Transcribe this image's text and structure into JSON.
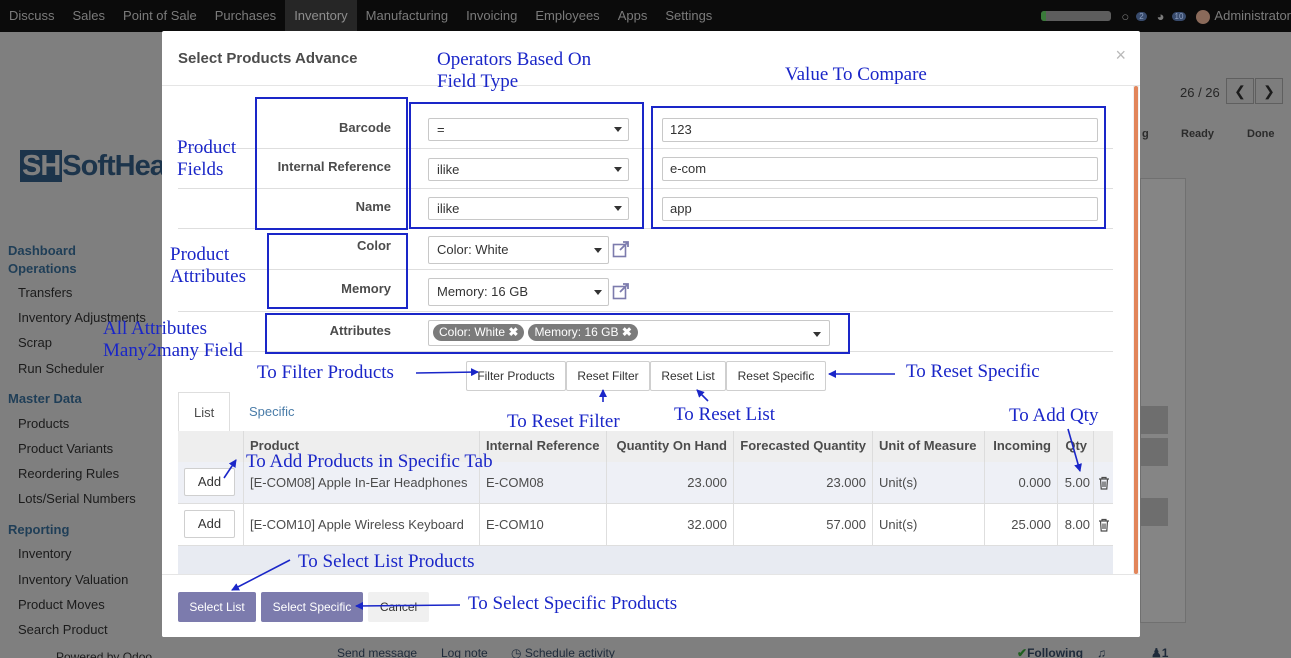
{
  "topbar": {
    "menu": [
      "Discuss",
      "Sales",
      "Point of Sale",
      "Purchases",
      "Inventory",
      "Manufacturing",
      "Invoicing",
      "Employees",
      "Apps",
      "Settings"
    ],
    "active_menu": "Inventory",
    "badge_chat": "2",
    "badge_activity": "10",
    "user": "Administrator"
  },
  "sidebar": {
    "logo_text": "Soft",
    "dashboard_heading": "Dashboard Operations",
    "ops_items": [
      "Transfers",
      "Inventory Adjustments",
      "Scrap",
      "Run Scheduler"
    ],
    "master_heading": "Master Data",
    "master_items": [
      "Products",
      "Product Variants",
      "Reordering Rules",
      "Lots/Serial Numbers"
    ],
    "reporting_heading": "Reporting",
    "reporting_items": [
      "Inventory",
      "Inventory Valuation",
      "Product Moves",
      "Search Product"
    ],
    "powered": "Powered by Odoo"
  },
  "background": {
    "pager": "26 / 26",
    "stage_ready": "Ready",
    "stage_done": "Done",
    "stage_partial": "g",
    "send_message": "Send message",
    "log_note": "Log note",
    "schedule_activity": "Schedule activity",
    "following": "Following",
    "followers": "1"
  },
  "modal": {
    "title": "Select Products Advance",
    "close": "×",
    "fields": [
      {
        "label": "Barcode",
        "operator": "=",
        "value": "123"
      },
      {
        "label": "Internal Reference",
        "operator": "ilike",
        "value": "e-com"
      },
      {
        "label": "Name",
        "operator": "ilike",
        "value": "app"
      }
    ],
    "attributes": [
      {
        "label": "Color",
        "value": "Color: White"
      },
      {
        "label": "Memory",
        "value": "Memory: 16 GB"
      }
    ],
    "attributes_label": "Attributes",
    "attribute_tags": [
      "Color: White",
      "Memory: 16 GB"
    ],
    "buttons": {
      "filter": "Filter Products",
      "reset_filter": "Reset Filter",
      "reset_list": "Reset List",
      "reset_specific": "Reset Specific"
    },
    "tabs": [
      "List",
      "Specific"
    ],
    "table": {
      "headers": [
        "Product",
        "Internal Reference",
        "Quantity On Hand",
        "Forecasted Quantity",
        "Unit of Measure",
        "Incoming",
        "Qty"
      ],
      "add_label": "Add",
      "rows": [
        {
          "product": "[E-COM08] Apple In-Ear Headphones",
          "ref": "E-COM08",
          "onhand": "23.000",
          "forecast": "23.000",
          "uom": "Unit(s)",
          "incoming": "0.000",
          "qty": "5.00"
        },
        {
          "product": "[E-COM10] Apple Wireless Keyboard",
          "ref": "E-COM10",
          "onhand": "32.000",
          "forecast": "57.000",
          "uom": "Unit(s)",
          "incoming": "25.000",
          "qty": "8.00"
        }
      ]
    },
    "footer": {
      "select_list": "Select List",
      "select_specific": "Select Specific",
      "cancel": "Cancel"
    }
  },
  "annotations": {
    "operators": "Operators Based On Field Type",
    "operators_l1": "Operators Based On",
    "operators_l2": "Field Type",
    "value_compare": "Value To Compare",
    "product_fields_l1": "Product",
    "product_fields_l2": "Fields",
    "product_attrs_l1": "Product",
    "product_attrs_l2": "Attributes",
    "all_attrs_l1": "All Attributes",
    "all_attrs_l2": "Many2many Field",
    "to_filter": "To Filter Products",
    "to_reset_specific": "To Reset Specific",
    "to_reset_filter": "To Reset Filter",
    "to_reset_list": "To Reset List",
    "to_add_qty": "To Add Qty",
    "to_add_products": "To Add Products in Specific Tab",
    "to_select_list": "To Select List Products",
    "to_select_specific": "To Select Specific Products"
  },
  "colors": {
    "annotation": "#1a26c8",
    "primary_button": "#7c7bad",
    "link": "#4a7ca8",
    "scroll_accent": "#e2855a"
  }
}
